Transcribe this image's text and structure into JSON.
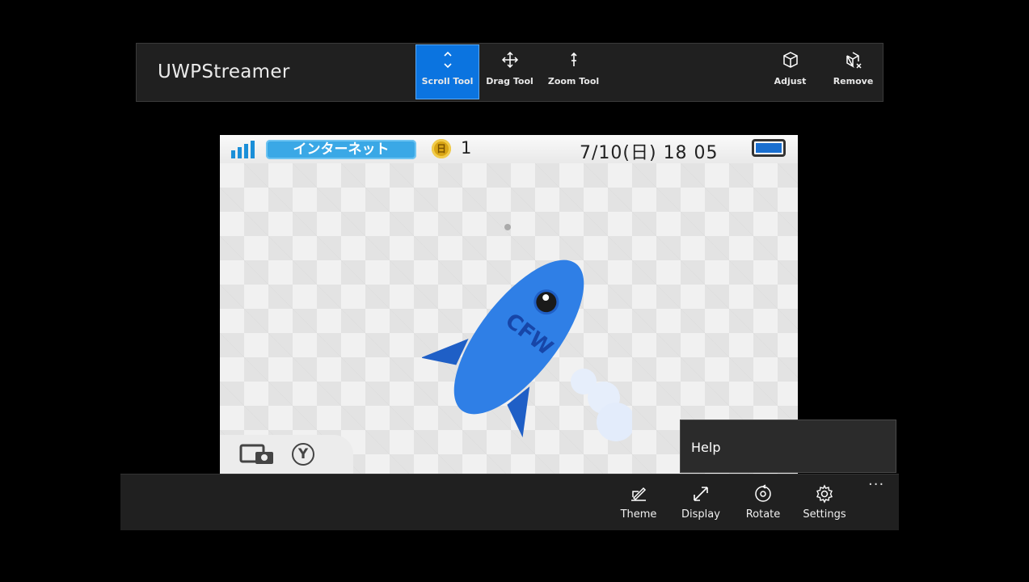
{
  "app": {
    "title": "UWPStreamer"
  },
  "toolbar": {
    "tools": [
      {
        "label": "Scroll Tool",
        "icon": "scroll-icon",
        "active": true
      },
      {
        "label": "Drag Tool",
        "icon": "drag-icon",
        "active": false
      },
      {
        "label": "Zoom Tool",
        "icon": "zoom-icon",
        "active": false
      }
    ],
    "actions": [
      {
        "label": "Adjust",
        "icon": "adjust-cube-icon"
      },
      {
        "label": "Remove",
        "icon": "remove-cube-icon"
      }
    ]
  },
  "screen": {
    "status": {
      "network_label": "インターネット",
      "coins": "1",
      "datetime": "7/10(日) 18 05"
    },
    "rocket_text": "CFW",
    "y_button": "Y"
  },
  "help_menu": {
    "item": "Help"
  },
  "bottom_bar": {
    "buttons": [
      {
        "label": "Theme",
        "icon": "theme-pen-icon"
      },
      {
        "label": "Display",
        "icon": "resize-arrows-icon"
      },
      {
        "label": "Rotate",
        "icon": "rotate-icon"
      },
      {
        "label": "Settings",
        "icon": "gear-icon"
      }
    ],
    "more": "···"
  },
  "colors": {
    "accent": "#0b74e0",
    "bar": "#202020",
    "rocket": "#2f7fe6"
  }
}
